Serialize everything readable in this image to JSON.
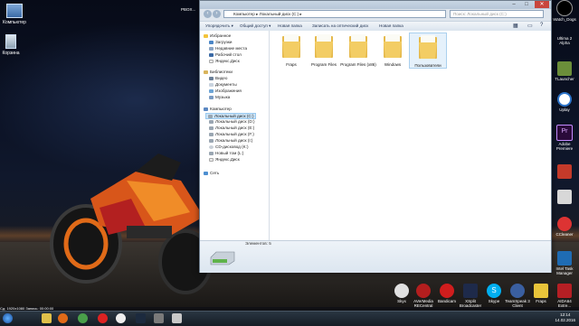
{
  "desktop": {
    "left_icons": [
      {
        "label": "Компьютер",
        "icon": "computer-icon"
      },
      {
        "label": "Корзина",
        "icon": "recycle-bin-icon"
      }
    ],
    "right_icons": [
      {
        "label": "",
        "icon": "nvidia-icon"
      },
      {
        "label": "Ultima 2 Alpha",
        "icon": "game-icon"
      },
      {
        "label": "TLauncher",
        "icon": "minecraft-icon"
      },
      {
        "label": "Uplay",
        "icon": "uplay-icon"
      },
      {
        "label": "Adobe Premiere",
        "icon": "premiere-icon"
      },
      {
        "label": "",
        "icon": "ccleaner-icon"
      },
      {
        "label": "",
        "icon": "gears-icon"
      },
      {
        "label": "CCleaner",
        "icon": "ccleaner2-icon"
      },
      {
        "label": "Intel Task Manager",
        "icon": "intel-icon"
      }
    ],
    "bottom_icons": [
      {
        "label": "Skyx",
        "icon": "skype-like-icon"
      },
      {
        "label": "AVerMedia RECentral",
        "icon": "avermedia-icon"
      },
      {
        "label": "Bandicam",
        "icon": "bandicam-icon"
      },
      {
        "label": "XSplit Broadcaster",
        "icon": "xsplit-icon"
      },
      {
        "label": "Skype",
        "icon": "skype-icon"
      },
      {
        "label": "TeamSpeak 3 Client",
        "icon": "teamspeak-icon"
      },
      {
        "label": "Fraps",
        "icon": "fraps-icon"
      },
      {
        "label": "AIDA64 Extre...",
        "icon": "aida-icon"
      }
    ],
    "top_left_text": "PBOX...",
    "nvidia_label": "Watch_Dogs"
  },
  "explorer": {
    "address_path": [
      "Компьютер",
      "Локальный диск (C:)"
    ],
    "search_placeholder": "Поиск: Локальный диск (C:)",
    "toolbar": [
      "Упорядочить ▾",
      "Общий доступ ▾",
      "Новая папка",
      "Записать на оптический диск",
      "Новая папка"
    ],
    "nav": [
      {
        "label": "Избранное",
        "icon": "star-icon",
        "level": 0
      },
      {
        "label": "Загрузки",
        "icon": "downloads-icon",
        "level": 1
      },
      {
        "label": "Недавние места",
        "icon": "recent-icon",
        "level": 1
      },
      {
        "label": "Рабочий стол",
        "icon": "desktop-icon",
        "level": 1
      },
      {
        "label": "Яндекс.Диск",
        "icon": "yadisk-icon",
        "level": 1
      },
      {
        "label": "Библиотеки",
        "icon": "library-icon",
        "level": 0
      },
      {
        "label": "Видео",
        "icon": "video-icon",
        "level": 1
      },
      {
        "label": "Документы",
        "icon": "documents-icon",
        "level": 1
      },
      {
        "label": "Изображения",
        "icon": "images-icon",
        "level": 1
      },
      {
        "label": "Музыка",
        "icon": "music-icon",
        "level": 1
      },
      {
        "label": "Компьютер",
        "icon": "computer-icon",
        "level": 0
      },
      {
        "label": "Локальный диск (C:)",
        "icon": "drive-icon",
        "level": 1,
        "selected": true
      },
      {
        "label": "Локальный диск (D:)",
        "icon": "drive-icon",
        "level": 1
      },
      {
        "label": "Локальный диск (E:)",
        "icon": "drive-icon",
        "level": 1
      },
      {
        "label": "Локальный диск (F:)",
        "icon": "drive-icon",
        "level": 1
      },
      {
        "label": "Локальный диск (I:)",
        "icon": "drive-icon",
        "level": 1
      },
      {
        "label": "CD-дисковод (K:)",
        "icon": "cd-icon",
        "level": 1
      },
      {
        "label": "Новый том (L:)",
        "icon": "drive-icon",
        "level": 1
      },
      {
        "label": "Яндекс.Диск",
        "icon": "yadisk-icon",
        "level": 1
      },
      {
        "label": "Сеть",
        "icon": "network-icon",
        "level": 0
      }
    ],
    "folders": [
      {
        "label": "Fraps"
      },
      {
        "label": "Program Files"
      },
      {
        "label": "Program Files (x86)"
      },
      {
        "label": "Windows"
      },
      {
        "label": "Пользователи",
        "selected": true
      }
    ],
    "status": "Элементов: 5"
  },
  "taskbar": {
    "clock_time": "12:14",
    "clock_date": "14.02.2016",
    "sysinfo": "Сд: 1920x1080   Запись: 00:00:00"
  },
  "colors": {
    "folder": "#f0c75c",
    "selection": "#cce4f7",
    "window_frame": "#dfe6ee"
  }
}
